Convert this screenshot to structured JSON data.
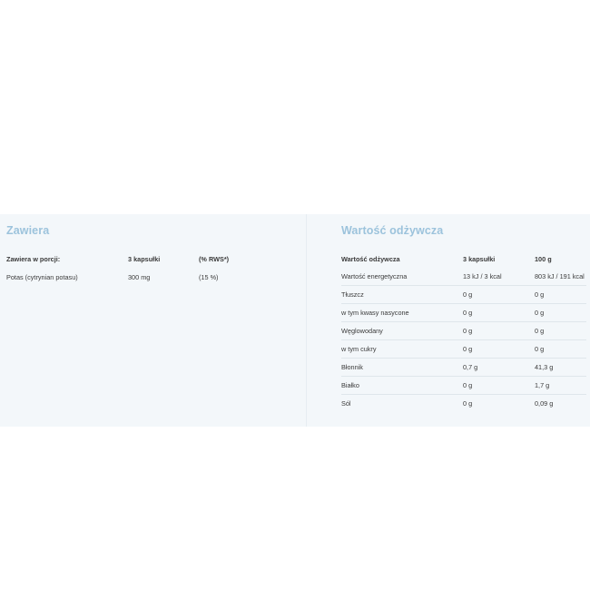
{
  "contains": {
    "title": "Zawiera",
    "headers": [
      "Zawiera w porcji:",
      "3 kapsułki",
      "(% RWS*)"
    ],
    "rows": [
      [
        "Potas (cytrynian potasu)",
        "300 mg",
        "(15 %)"
      ]
    ]
  },
  "nutrition": {
    "title": "Wartość odżywcza",
    "headers": [
      "Wartość odżywcza",
      "3 kapsułki",
      "100 g"
    ],
    "rows": [
      [
        "Wartość energetyczna",
        "13 kJ / 3 kcal",
        "803 kJ / 191 kcal"
      ],
      [
        "Tłuszcz",
        "0 g",
        "0 g"
      ],
      [
        "w tym kwasy nasycone",
        "0 g",
        "0 g"
      ],
      [
        "Węglowodany",
        "0 g",
        "0 g"
      ],
      [
        "w tym cukry",
        "0 g",
        "0 g"
      ],
      [
        "Błonnik",
        "0,7 g",
        "41,3 g"
      ],
      [
        "Białko",
        "0 g",
        "1,7 g"
      ],
      [
        "Sól",
        "0 g",
        "0,09 g"
      ]
    ]
  }
}
